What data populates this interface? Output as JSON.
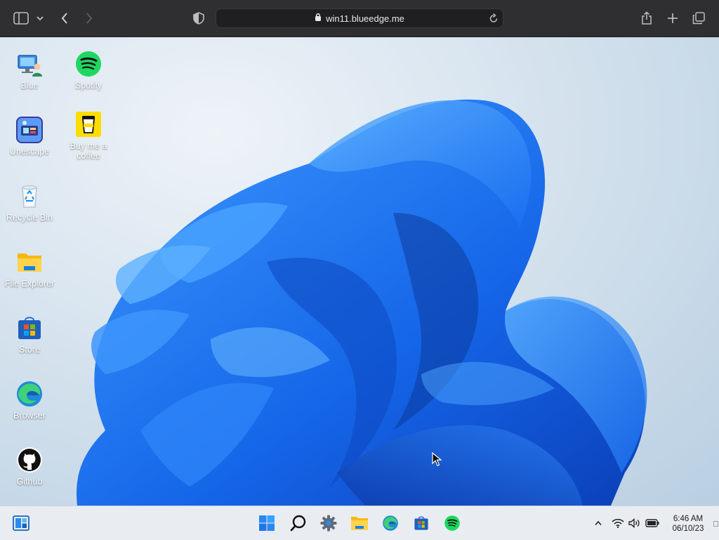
{
  "browser": {
    "url": "win11.blueedge.me",
    "icons": [
      "sidebar-icon",
      "chevron-down-icon",
      "back-icon",
      "forward-icon",
      "shield-icon",
      "lock-icon",
      "reload-icon",
      "share-icon",
      "plus-icon",
      "tabs-icon"
    ]
  },
  "desktop": {
    "icons": [
      {
        "label": "Blue",
        "icon": "computer-user-icon"
      },
      {
        "label": "Spotify",
        "icon": "spotify-icon"
      },
      {
        "label": "Unescape",
        "icon": "unescape-icon"
      },
      {
        "label": "Buy me a coffee",
        "icon": "coffee-cup-icon"
      },
      {
        "label": "Recycle Bin",
        "icon": "recycle-bin-icon"
      },
      {
        "label": "File Explorer",
        "icon": "folder-icon"
      },
      {
        "label": "Store",
        "icon": "store-icon"
      },
      {
        "label": "Browser",
        "icon": "edge-icon"
      },
      {
        "label": "Github",
        "icon": "github-icon"
      }
    ]
  },
  "taskbar": {
    "apps": [
      "widgets-icon",
      "start-icon",
      "search-icon",
      "settings-icon",
      "file-explorer-icon",
      "edge-icon",
      "store-icon",
      "spotify-icon"
    ],
    "tray": [
      "chevron-up-icon",
      "wifi-icon",
      "volume-icon",
      "battery-icon"
    ],
    "time": "6:46 AM",
    "date": "06/10/23"
  },
  "colors": {
    "accent": "#1a6ff0",
    "taskbar": "#e9edf2",
    "chrome": "#2f2f31"
  }
}
